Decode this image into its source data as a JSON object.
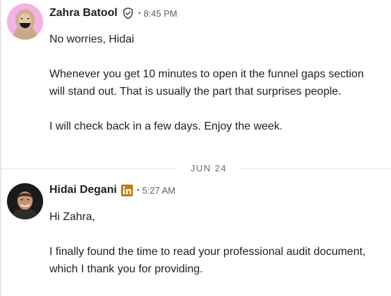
{
  "messages": [
    {
      "sender": "Zahra Batool",
      "badge_icon": "verified-shield-icon",
      "separator": "•",
      "time": "8:45 PM",
      "paragraphs": [
        "No worries, Hidai",
        "Whenever you get 10 minutes to open it the funnel gaps section will stand out. That is usually the part that surprises people.",
        "I will check back in a few days. Enjoy the week."
      ]
    },
    {
      "sender": "Hidai Degani",
      "badge_icon": "linkedin-icon",
      "separator": "•",
      "time": "5:27 AM",
      "paragraphs": [
        "Hi Zahra,",
        "I finally found the time to read your professional audit document, which I thank you for providing."
      ]
    }
  ],
  "date_divider": {
    "label": "JUN 24"
  },
  "colors": {
    "text": "#1f1f1f",
    "muted": "#5e5e5e",
    "divider": "#e4e4e4",
    "linkedin_badge": "#c37d16",
    "zahra_avatar_bg": "#f3b3e4"
  }
}
